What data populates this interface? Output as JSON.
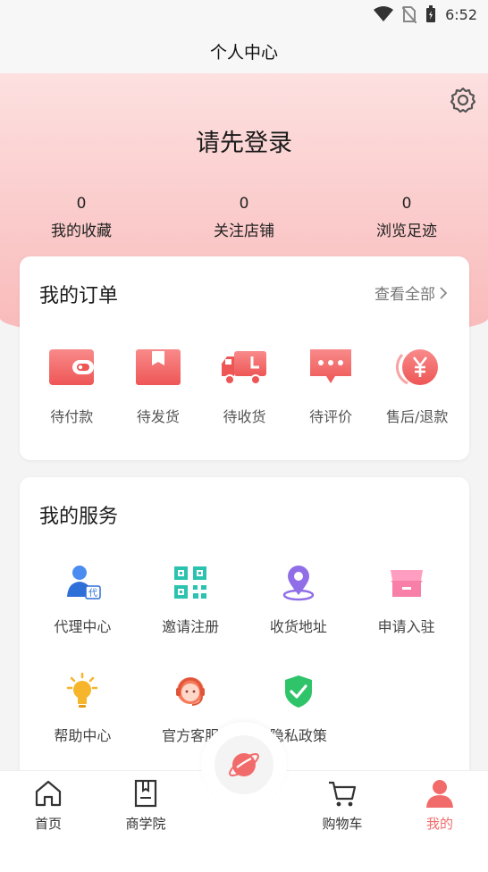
{
  "status_bar": {
    "time": "6:52"
  },
  "nav": {
    "title": "个人中心"
  },
  "header": {
    "login_prompt": "请先登录",
    "stats": [
      {
        "value": "0",
        "label": "我的收藏"
      },
      {
        "value": "0",
        "label": "关注店铺"
      },
      {
        "value": "0",
        "label": "浏览足迹"
      }
    ]
  },
  "orders": {
    "title": "我的订单",
    "view_all": "查看全部",
    "items": [
      {
        "label": "待付款",
        "icon": "wallet-icon"
      },
      {
        "label": "待发货",
        "icon": "package-icon"
      },
      {
        "label": "待收货",
        "icon": "truck-icon"
      },
      {
        "label": "待评价",
        "icon": "comment-icon"
      },
      {
        "label": "售后/退款",
        "icon": "refund-icon"
      }
    ]
  },
  "services": {
    "title": "我的服务",
    "items": [
      {
        "label": "代理中心",
        "icon": "agent-icon"
      },
      {
        "label": "邀请注册",
        "icon": "qrcode-icon"
      },
      {
        "label": "收货地址",
        "icon": "location-icon"
      },
      {
        "label": "申请入驻",
        "icon": "store-icon"
      },
      {
        "label": "帮助中心",
        "icon": "lightbulb-icon"
      },
      {
        "label": "官方客服",
        "icon": "customer-service-icon"
      },
      {
        "label": "隐私政策",
        "icon": "shield-check-icon"
      }
    ]
  },
  "tabs": [
    {
      "label": "首页",
      "icon": "home-icon"
    },
    {
      "label": "商学院",
      "icon": "book-icon"
    },
    {
      "label": "购物车",
      "icon": "cart-icon"
    },
    {
      "label": "我的",
      "icon": "user-icon"
    }
  ],
  "colors": {
    "accent": "#f26b6b",
    "header_top": "#fde0e0",
    "header_bottom": "#f9b9b9"
  }
}
